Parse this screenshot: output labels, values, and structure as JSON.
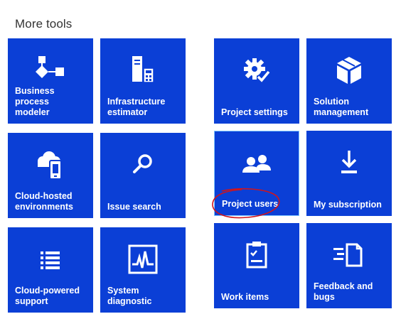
{
  "section": {
    "title": "More tools"
  },
  "tiles": [
    {
      "label": "Business process\nmodeler",
      "icon": "process-flow-icon"
    },
    {
      "label": "Infrastructure\nestimator",
      "icon": "server-calculator-icon"
    },
    {
      "label": "Project settings",
      "icon": "gear-check-icon"
    },
    {
      "label": "Solution\nmanagement",
      "icon": "package-icon"
    },
    {
      "label": "Cloud-hosted\nenvironments",
      "icon": "cloud-device-icon"
    },
    {
      "label": "Issue search",
      "icon": "search-icon"
    },
    {
      "label": "Project users",
      "icon": "users-icon"
    },
    {
      "label": "My subscription",
      "icon": "download-icon"
    },
    {
      "label": "Cloud-powered\nsupport",
      "icon": "list-icon"
    },
    {
      "label": "System\ndiagnostic",
      "icon": "heartbeat-monitor-icon"
    },
    {
      "label": "Work items",
      "icon": "clipboard-check-icon"
    },
    {
      "label": "Feedback and\nbugs",
      "icon": "feedback-document-icon"
    }
  ],
  "colors": {
    "tile": "#0b3fd6",
    "selected_border": "#7cc4ff",
    "annotation": "#d0141c"
  },
  "annotation": {
    "type": "hand-drawn-circle",
    "target": "Project users"
  }
}
